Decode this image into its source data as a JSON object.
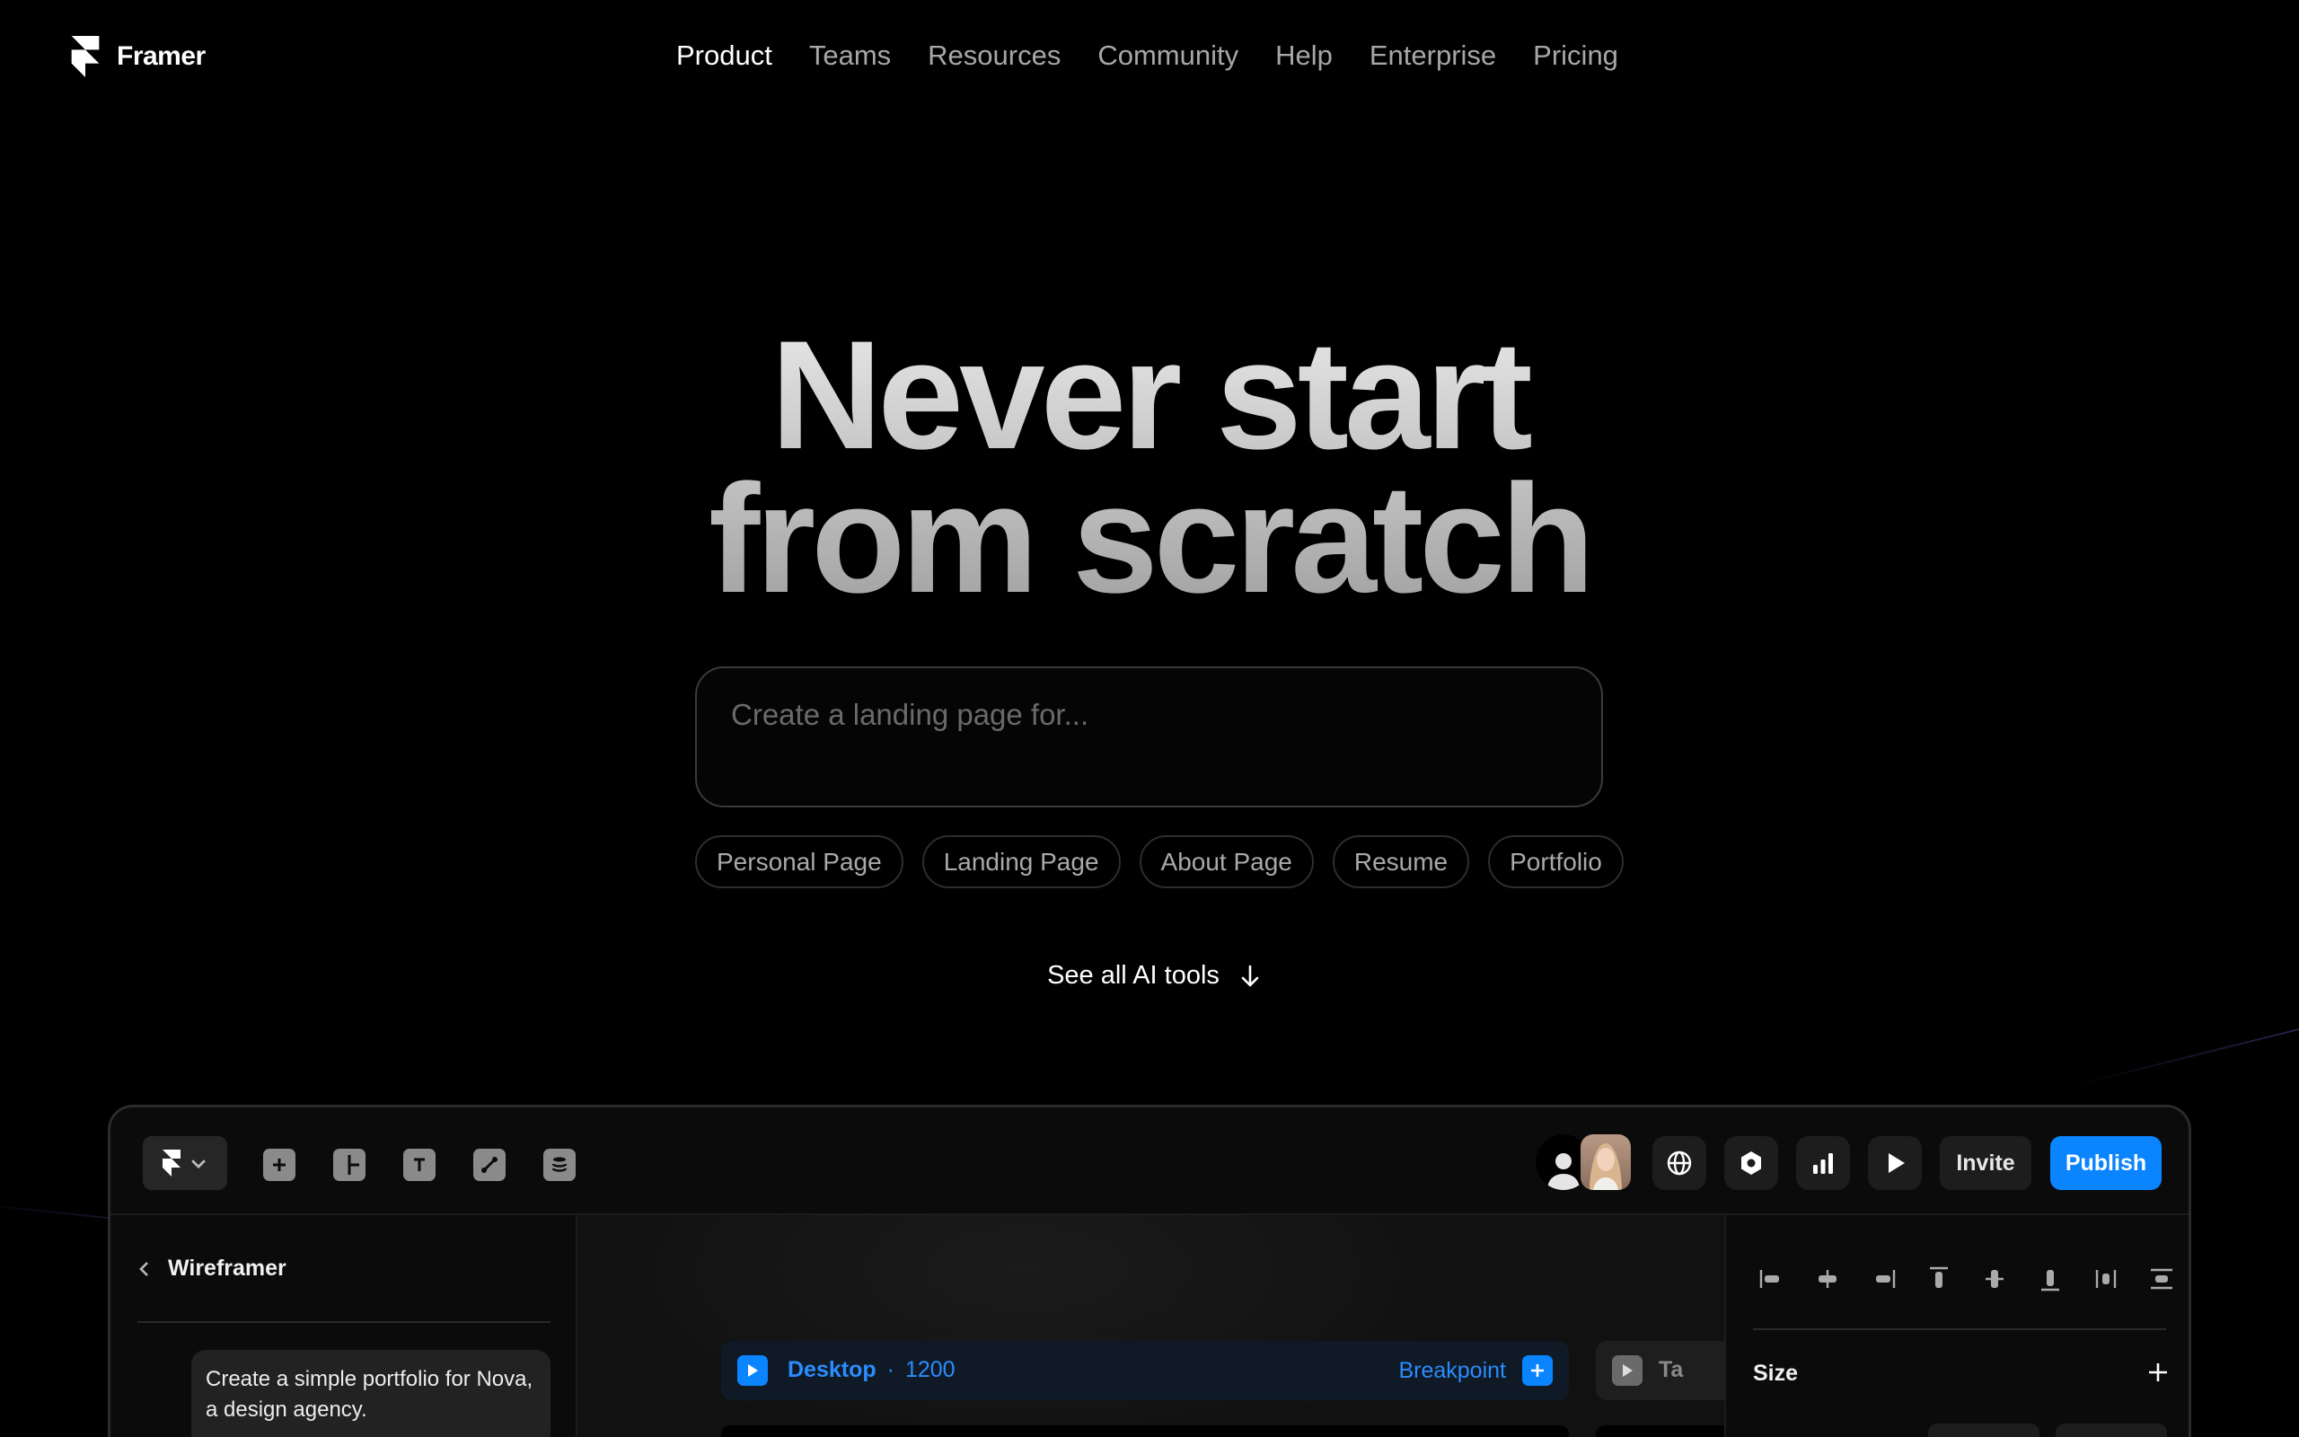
{
  "brand": {
    "name": "Framer"
  },
  "nav": {
    "links": [
      "Product",
      "Teams",
      "Resources",
      "Community",
      "Help",
      "Enterprise",
      "Pricing"
    ],
    "active_index": 0
  },
  "hero": {
    "title_line1": "Never start",
    "title_line2": "from scratch",
    "prompt_placeholder": "Create a landing page for...",
    "chips": [
      "Personal Page",
      "Landing Page",
      "About Page",
      "Resume",
      "Portfolio"
    ],
    "see_all": "See all AI tools"
  },
  "app": {
    "toolbar": {
      "tools": [
        "add-icon",
        "layout-icon",
        "text-icon",
        "vector-icon",
        "cms-icon"
      ],
      "right_icons": [
        "globe-icon",
        "settings-icon",
        "analytics-icon",
        "preview-play-icon"
      ],
      "invite_label": "Invite",
      "publish_label": "Publish"
    },
    "left_panel": {
      "title": "Wireframer",
      "message": "Create a simple portfolio for Nova, a design agency."
    },
    "canvas": {
      "breakpoint_name": "Desktop",
      "breakpoint_sep": "·",
      "breakpoint_width": "1200",
      "breakpoint_action": "Breakpoint",
      "second_breakpoint_partial": "Ta"
    },
    "right_panel": {
      "size_label": "Size"
    }
  },
  "colors": {
    "accent": "#0a84ff",
    "background": "#000000",
    "nav_muted": "#a7a7a7"
  }
}
